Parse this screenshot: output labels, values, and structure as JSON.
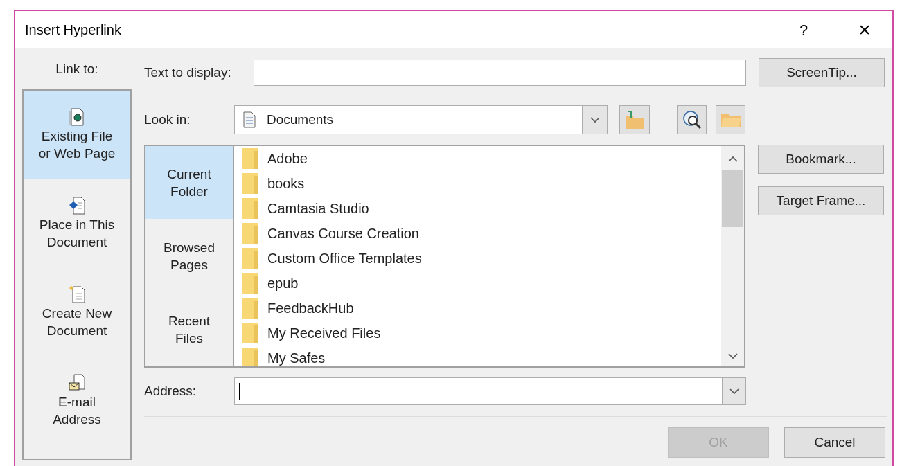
{
  "window": {
    "title": "Insert Hyperlink",
    "help": "?",
    "close": "×"
  },
  "link_to": {
    "label": "Link to:",
    "items": [
      {
        "kind": "file",
        "label": "Existing File\nor Web Page",
        "selected": true
      },
      {
        "kind": "place",
        "label": "Place in This\nDocument",
        "selected": false
      },
      {
        "kind": "new",
        "label": "Create New\nDocument",
        "selected": false
      },
      {
        "kind": "email",
        "label": "E-mail\nAddress",
        "selected": false
      }
    ]
  },
  "text_to_display": {
    "label": "Text to display:"
  },
  "look_in": {
    "label": "Look in:",
    "value": "Documents"
  },
  "browse_nav": [
    {
      "label": "Current\nFolder",
      "selected": true
    },
    {
      "label": "Browsed\nPages",
      "selected": false
    },
    {
      "label": "Recent\nFiles",
      "selected": false
    }
  ],
  "files": [
    "Adobe",
    "books",
    "Camtasia Studio",
    "Canvas Course Creation",
    "Custom Office Templates",
    "epub",
    "FeedbackHub",
    "My Received Files",
    "My Safes"
  ],
  "address": {
    "label": "Address:",
    "focused": true
  },
  "side_buttons": [
    "ScreenTip...",
    "Bookmark...",
    "Target Frame..."
  ],
  "footer_buttons": [
    {
      "label": "OK",
      "disabled": true
    },
    {
      "label": "Cancel",
      "disabled": false
    }
  ]
}
